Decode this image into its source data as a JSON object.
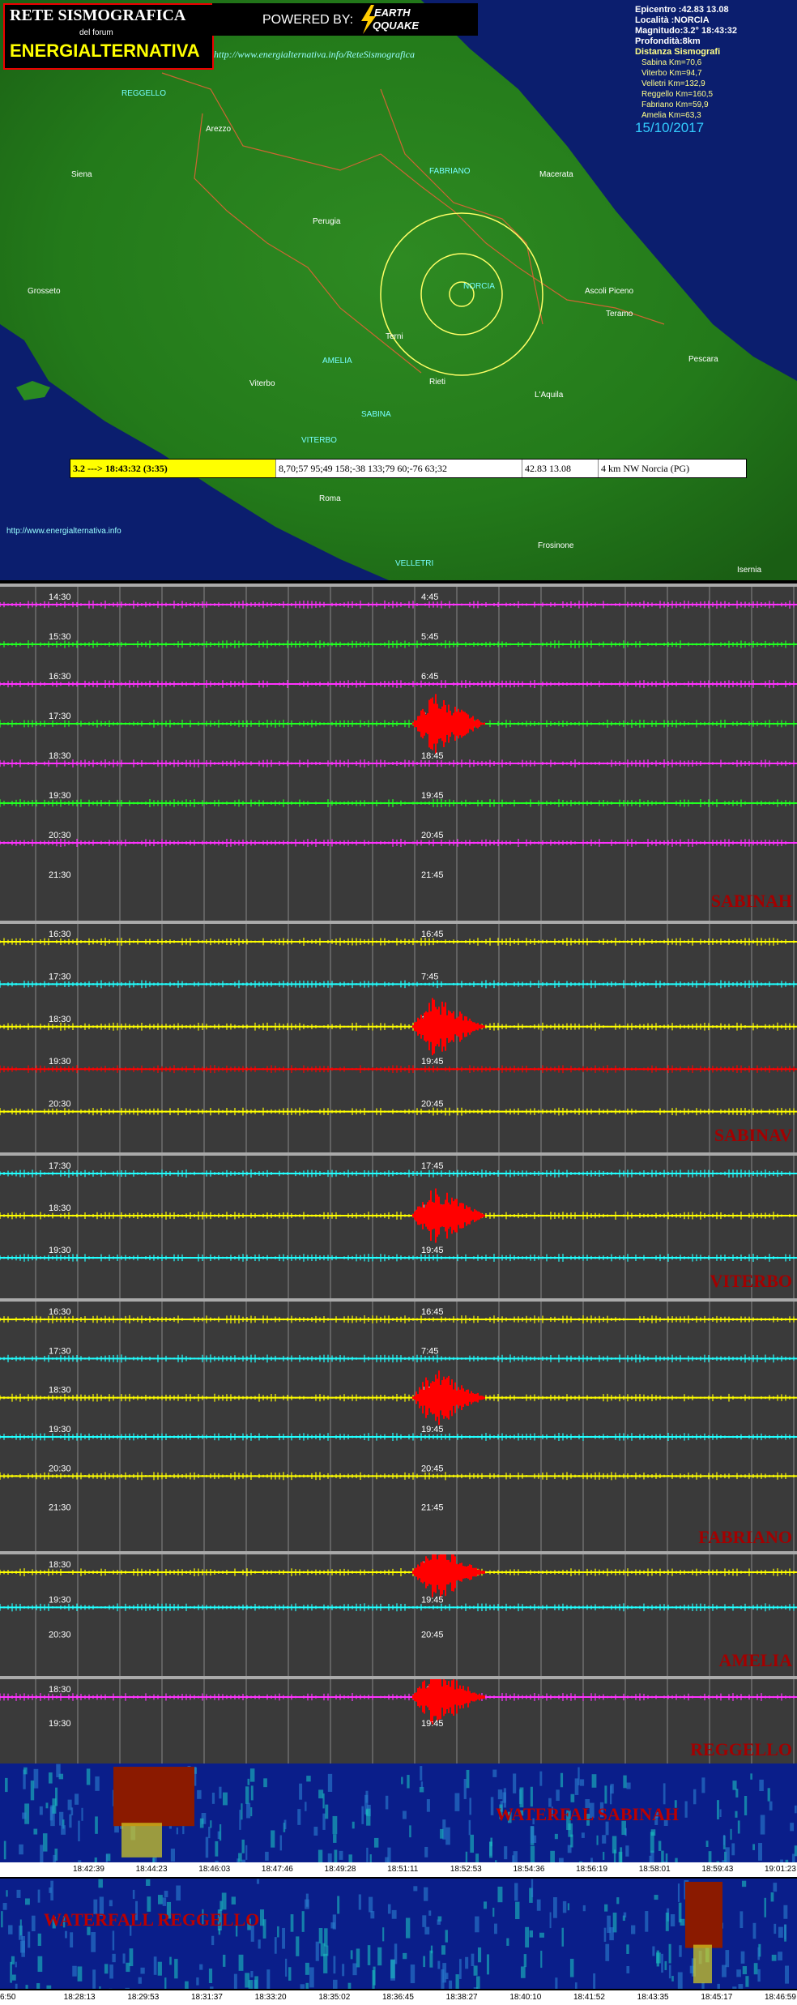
{
  "header": {
    "logo_line1": "RETE SISMOGRAFICA",
    "logo_line2": "del forum",
    "logo_line3": "ENERGIALTERNATIVA",
    "powered_by": "POWERED BY:",
    "eq_logo_line1": "EARTH",
    "eq_logo_line2": "QQUAKE",
    "url": "http://www.energialternativa.info/ReteSismografica"
  },
  "event_info": {
    "epicentro": "Epicentro :42.83 13.08",
    "localita": "Località :NORCIA",
    "magnitudo": "Magnitudo:3.2°  18:43:32",
    "profondita": "Profondità:8km",
    "distanza_title": "Distanza Sismografi",
    "distances": [
      "Sabina Km=70,6",
      "Viterbo Km=94,7",
      "Velletri Km=132,9",
      "Reggello Km=160,5",
      "Fabriano Km=59,9",
      "Amelia Km=63,3"
    ],
    "date": "15/10/2017"
  },
  "map": {
    "labels": [
      "REGGELLO",
      "Arezzo",
      "Siena",
      "FABRIANO",
      "Macerata",
      "Perugia",
      "NORCIA",
      "Ascoli Piceno",
      "Teramo",
      "Grosseto",
      "Terni",
      "AMELIA",
      "Viterbo",
      "Rieti",
      "L'Aquila",
      "Pescara",
      "SABINA",
      "VITERBO",
      "Roma",
      "VELLETRI",
      "Frosinone",
      "Isernia"
    ],
    "footer_url": "http://www.energialternativa.info"
  },
  "event_bar": {
    "mag_time": "3.2 ---> 18:43:32 (3:35)",
    "readings": "8,70;57 95;49 158;-38 133;79 60;-76 63;32",
    "coords": "42.83 13.08",
    "place": "4 km NW Norcia (PG)"
  },
  "colors": {
    "magenta": "#ff33ff",
    "green": "#22ff22",
    "yellow": "#ffff00",
    "cyan": "#22ffff",
    "red": "#ff0000"
  },
  "panels": [
    {
      "name": "SABINAH",
      "left_ticks": [
        "14:30",
        "15:30",
        "16:30",
        "17:30",
        "18:30",
        "19:30",
        "20:30",
        "21:30"
      ],
      "right_ticks": [
        "4:45",
        "5:45",
        "6:45",
        "7:45",
        "18:45",
        "19:45",
        "20:45",
        "21:45"
      ]
    },
    {
      "name": "SABINAV",
      "left_ticks": [
        "16:30",
        "17:30",
        "18:30",
        "19:30",
        "20:30"
      ],
      "right_ticks": [
        "16:45",
        "7:45",
        "18:45",
        "19:45",
        "20:45"
      ]
    },
    {
      "name": "VITERBO",
      "left_ticks": [
        "17:30",
        "18:30",
        "19:30"
      ],
      "right_ticks": [
        "17:45",
        "18:45",
        "19:45"
      ]
    },
    {
      "name": "FABRIANO",
      "left_ticks": [
        "16:30",
        "17:30",
        "18:30",
        "19:30",
        "20:30",
        "21:30"
      ],
      "right_ticks": [
        "16:45",
        "7:45",
        "18:45",
        "19:45",
        "20:45",
        "21:45"
      ]
    },
    {
      "name": "AMELIA",
      "left_ticks": [
        "18:30",
        "19:30",
        "20:30"
      ],
      "right_ticks": [
        "18:45",
        "19:45",
        "20:45"
      ]
    },
    {
      "name": "REGGELLO",
      "left_ticks": [
        "18:30",
        "19:30"
      ],
      "right_ticks": [
        "18",
        "19:45"
      ]
    }
  ],
  "waterfalls": [
    {
      "title": "WATERFAL SABINAH",
      "ticks": [
        "18:42:39",
        "18:44:23",
        "18:46:03",
        "18:47:46",
        "18:49:28",
        "18:51:11",
        "18:52:53",
        "18:54:36",
        "18:56:19",
        "18:58:01",
        "18:59:43",
        "19:01:23"
      ]
    },
    {
      "title": "WATERFALL REGGELLO",
      "ticks": [
        "6:50",
        "18:28:13",
        "18:29:53",
        "18:31:37",
        "18:33:20",
        "18:35:02",
        "18:36:45",
        "18:38:27",
        "18:40:10",
        "18:41:52",
        "18:43:35",
        "18:45:17",
        "18:46:59"
      ]
    }
  ]
}
